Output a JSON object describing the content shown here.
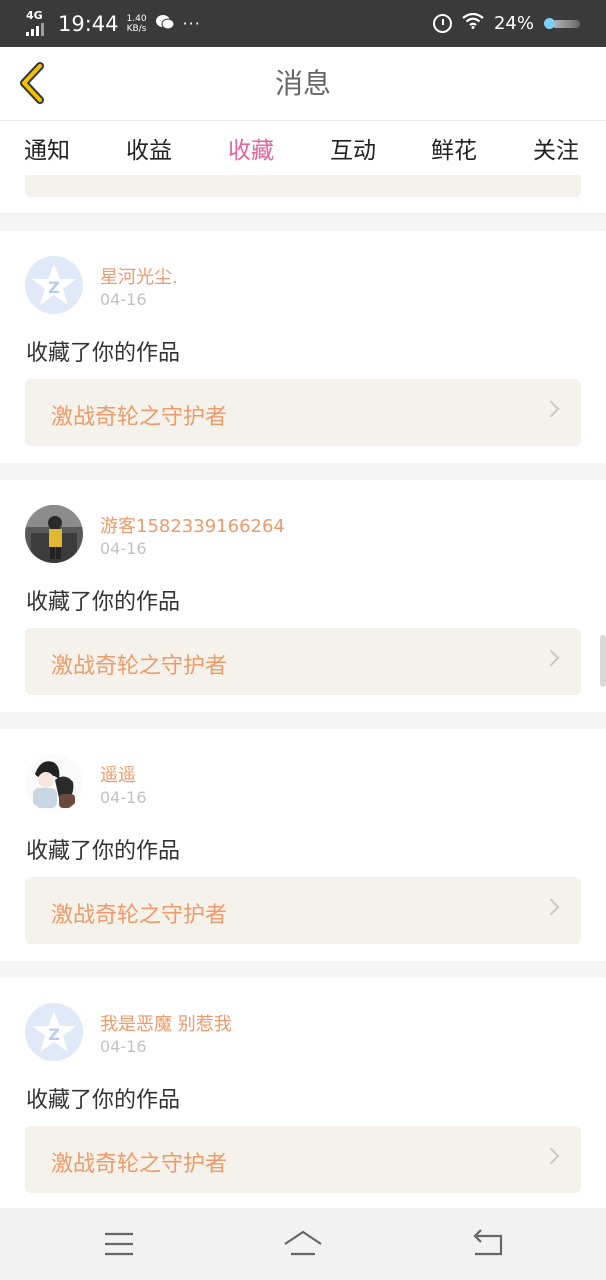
{
  "status_bar": {
    "network": "4G",
    "time": "19:44",
    "speed_value": "1.40",
    "speed_unit": "KB/s",
    "more": "···",
    "battery_text": "24%"
  },
  "header": {
    "title": "消息"
  },
  "tabs": [
    {
      "label": "通知"
    },
    {
      "label": "收益"
    },
    {
      "label": "收藏",
      "active": true
    },
    {
      "label": "互动"
    },
    {
      "label": "鲜花"
    },
    {
      "label": "关注"
    }
  ],
  "notifications": [
    {
      "user": "星河光尘.",
      "date": "04-16",
      "action": "收藏了你的作品",
      "work": "激战奇轮之守护者",
      "avatar": "qq-default-avatar"
    },
    {
      "user": "游客1582339166264",
      "date": "04-16",
      "action": "收藏了你的作品",
      "work": "激战奇轮之守护者",
      "avatar": "photo-avatar"
    },
    {
      "user": "遥遥",
      "date": "04-16",
      "action": "收藏了你的作品",
      "work": "激战奇轮之守护者",
      "avatar": "anime-avatar"
    },
    {
      "user": "我是恶魔 别惹我",
      "date": "04-16",
      "action": "收藏了你的作品",
      "work": "激战奇轮之守护者",
      "avatar": "qq-default-avatar"
    }
  ],
  "colors": {
    "accent": "#e8609c",
    "username": "#ee9a6a",
    "work_bg": "#f4f2ea",
    "back_arrow": "#f2c200"
  }
}
